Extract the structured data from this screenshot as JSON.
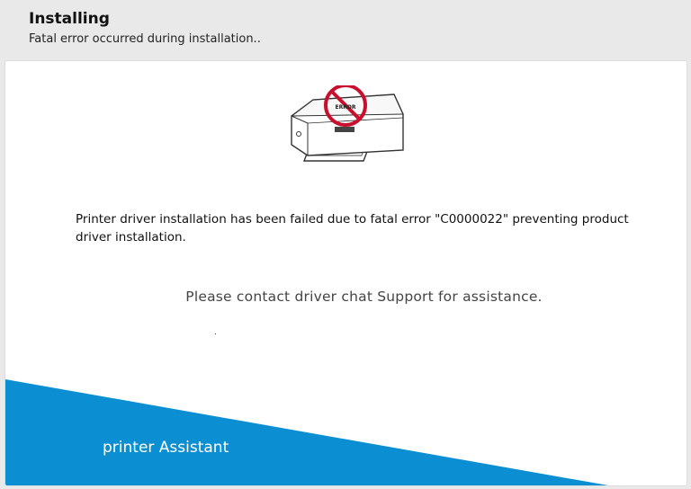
{
  "header": {
    "title": "Installing",
    "subtitle": "Fatal error occurred during installation.."
  },
  "illustration": {
    "name": "printer-error-icon",
    "badge_text": "ERROR",
    "colors": {
      "prohibition": "#c8102e"
    }
  },
  "body": {
    "message": "Printer driver installation has been failed due to fatal error \"C0000022\" preventing product driver installation.",
    "support": "Please contact driver chat Support for assistance."
  },
  "footer": {
    "label": "printer Assistant",
    "color": "#0c8fd2"
  }
}
